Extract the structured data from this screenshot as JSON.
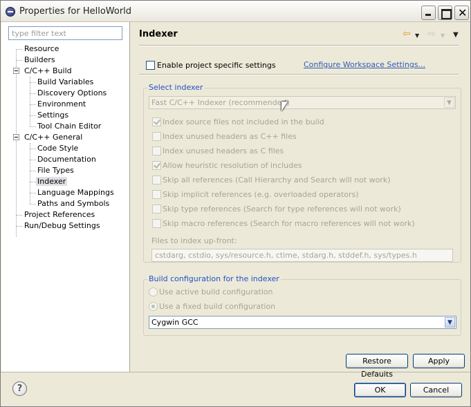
{
  "window": {
    "title": "Properties for HelloWorld"
  },
  "sidebar": {
    "filter_placeholder": "type filter text",
    "items": [
      {
        "label": "Resource"
      },
      {
        "label": "Builders"
      },
      {
        "label": "C/C++ Build"
      },
      {
        "label": "Build Variables"
      },
      {
        "label": "Discovery Options"
      },
      {
        "label": "Environment"
      },
      {
        "label": "Settings"
      },
      {
        "label": "Tool Chain Editor"
      },
      {
        "label": "C/C++ General"
      },
      {
        "label": "Code Style"
      },
      {
        "label": "Documentation"
      },
      {
        "label": "File Types"
      },
      {
        "label": "Indexer"
      },
      {
        "label": "Language Mappings"
      },
      {
        "label": "Paths and Symbols"
      },
      {
        "label": "Project References"
      },
      {
        "label": "Run/Debug Settings"
      }
    ],
    "selected": "Indexer"
  },
  "page": {
    "title": "Indexer",
    "enable_project_settings": "Enable project specific settings",
    "configure_workspace_link": "Configure Workspace Settings...",
    "select_indexer": {
      "group_title": "Select indexer",
      "combo_value": "Fast C/C++ Indexer (recommended)",
      "options": [
        {
          "label": "Index source files not included in the build",
          "checked": true
        },
        {
          "label": "Index unused headers as C++ files",
          "checked": false
        },
        {
          "label": "Index unused headers as C files",
          "checked": false
        },
        {
          "label": "Allow heuristic resolution of includes",
          "checked": true
        },
        {
          "label": "Skip all references (Call Hierarchy and Search will not work)",
          "checked": false
        },
        {
          "label": "Skip implicit references (e.g. overloaded operators)",
          "checked": false
        },
        {
          "label": "Skip type references (Search for type references will not work)",
          "checked": false
        },
        {
          "label": "Skip macro references (Search for macro references will not work)",
          "checked": false
        }
      ],
      "files_label": "Files to index up-front:",
      "files_value": "cstdarg, cstdio, sys/resource.h, ctime, stdarg.h, stddef.h, sys/types.h"
    },
    "build_config": {
      "group_title": "Build configuration for the indexer",
      "radio_active": "Use active build configuration",
      "radio_fixed": "Use a fixed build configuration",
      "combo_value": "Cygwin GCC"
    },
    "restore_defaults": "Restore Defaults",
    "apply": "Apply"
  },
  "footer": {
    "help_symbol": "?",
    "ok": "OK",
    "cancel": "Cancel"
  },
  "colors": {
    "dialog_bg": "#ece9d8",
    "group_title": "#2250c8",
    "link": "#2f5cb8",
    "disabled_text": "#a7a493"
  }
}
